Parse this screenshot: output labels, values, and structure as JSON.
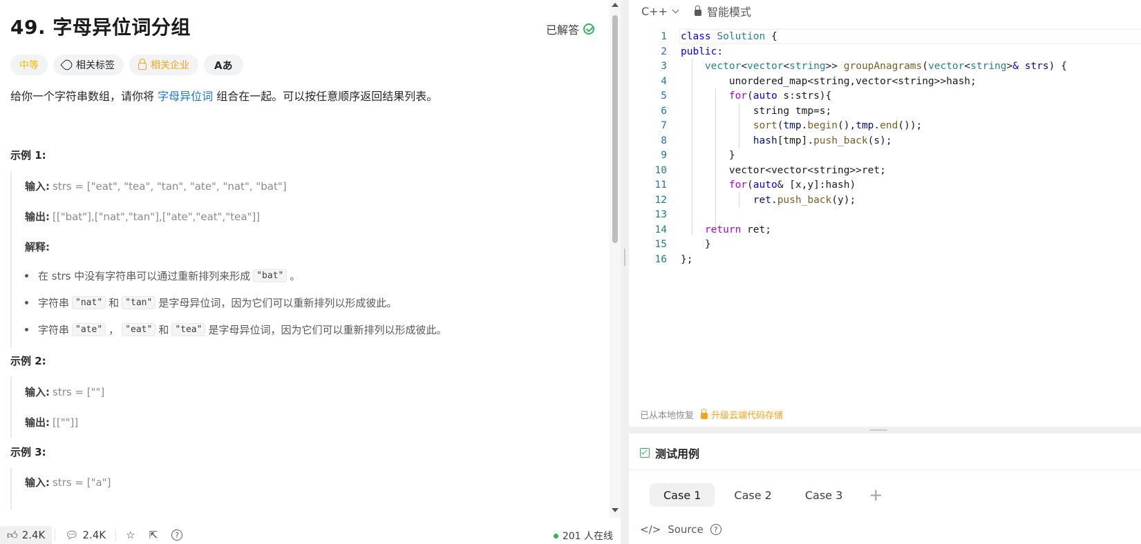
{
  "problem": {
    "title": "49. 字母异位词分组",
    "status": "已解答",
    "tags": {
      "difficulty": "中等",
      "related_tags": "相关标签",
      "related_companies": "相关企业",
      "translate": "Aあ"
    },
    "desc_before": "给你一个字符串数组，请你将 ",
    "desc_link": "字母异位词",
    "desc_after": " 组合在一起。可以按任意顺序返回结果列表。",
    "example1": {
      "heading": "示例 1:",
      "input_label": "输入:",
      "input_value": "strs = [\"eat\", \"tea\", \"tan\", \"ate\", \"nat\", \"bat\"]",
      "output_label": "输出:",
      "output_value": "[[\"bat\"],[\"nat\",\"tan\"],[\"ate\",\"eat\",\"tea\"]]",
      "explain_label": "解释:",
      "b1_pre": "在 strs 中没有字符串可以通过重新排列来形成 ",
      "b1_code": "\"bat\"",
      "b1_post": "。",
      "b2_pre": "字符串 ",
      "b2_code1": "\"nat\"",
      "b2_mid": " 和 ",
      "b2_code2": "\"tan\"",
      "b2_post": " 是字母异位词，因为它们可以重新排列以形成彼此。",
      "b3_pre": "字符串 ",
      "b3_code1": "\"ate\"",
      "b3_sep": " ，",
      "b3_code2": "\"eat\"",
      "b3_mid": " 和 ",
      "b3_code3": "\"tea\"",
      "b3_post": " 是字母异位词，因为它们可以重新排列以形成彼此。"
    },
    "example2": {
      "heading": "示例 2:",
      "input_label": "输入:",
      "input_value": "strs = [\"\"]",
      "output_label": "输出:",
      "output_value": "[[\"\"]]"
    },
    "example3": {
      "heading": "示例 3:",
      "input_label": "输入:",
      "input_value": "strs = [\"a\"]"
    }
  },
  "bottombar": {
    "likes": "2.4K",
    "comments": "2.4K",
    "online": "201 人在线"
  },
  "editor": {
    "language": "C++",
    "mode": "智能模式",
    "line_numbers": [
      "1",
      "2",
      "3",
      "4",
      "5",
      "6",
      "7",
      "8",
      "9",
      "10",
      "11",
      "12",
      "13",
      "14",
      "15",
      "16"
    ],
    "restored": "已从本地恢复",
    "upgrade": "升级云端代码存储"
  },
  "tests": {
    "title": "测试用例",
    "cases": [
      "Case 1",
      "Case 2",
      "Case 3"
    ],
    "plus": "+",
    "source": "Source",
    "help": "?"
  },
  "colors": {
    "difficulty": "#ffb800",
    "company": "#ffa116",
    "link": "#1a73e8",
    "accepted": "#2db55d"
  }
}
